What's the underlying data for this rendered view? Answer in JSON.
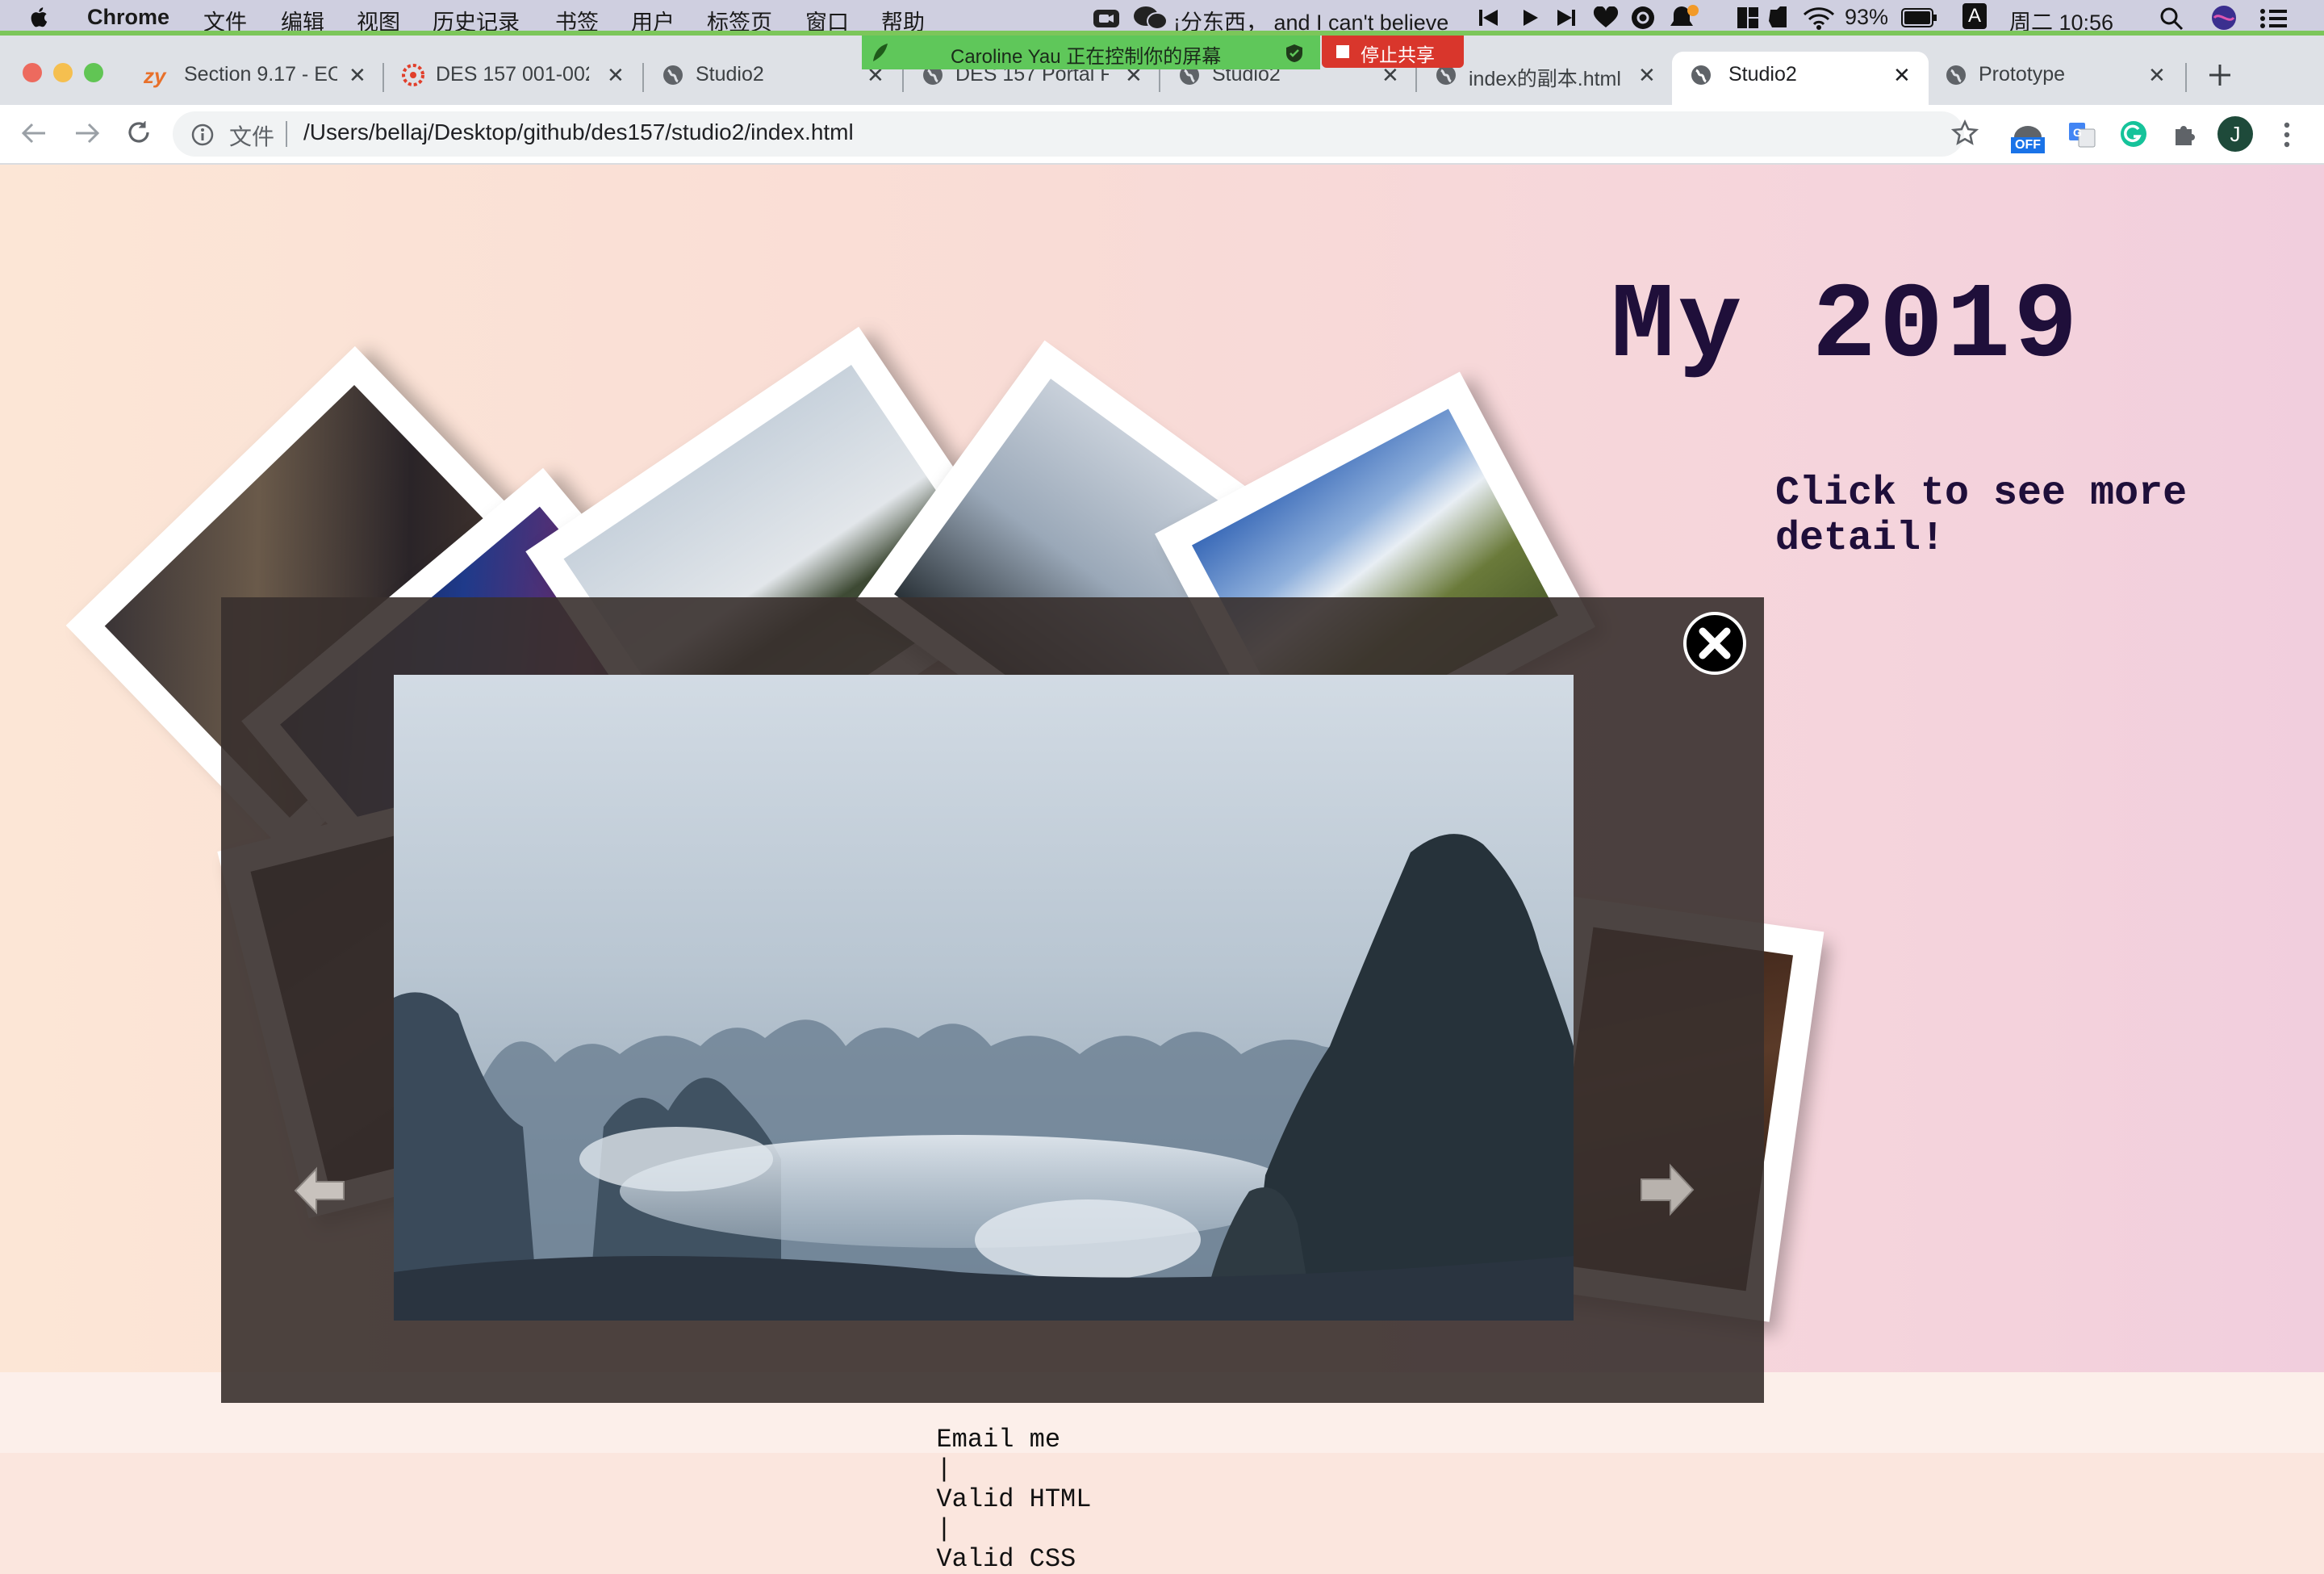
{
  "menubar": {
    "app": "Chrome",
    "items": [
      "文件",
      "编辑",
      "视图",
      "历史记录",
      "书签",
      "用户",
      "标签页",
      "窗口",
      "帮助"
    ],
    "now_playing": "¡分东西， and I can't believe",
    "battery": "93%",
    "clock": "周二 10:56",
    "input_method": "A"
  },
  "share_banner": {
    "text": "Caroline Yau 正在控制你的屏幕",
    "stop_label": "停止共享"
  },
  "tabs": [
    {
      "title": "Section 9.17 - EC",
      "favicon": "zy-icon",
      "active": false
    },
    {
      "title": "DES 157 001-002",
      "favicon": "canvas-icon",
      "active": false
    },
    {
      "title": "Studio2",
      "favicon": "globe-icon",
      "active": false
    },
    {
      "title": "DES 157 Portal F",
      "favicon": "globe-icon",
      "active": false
    },
    {
      "title": "Studio2",
      "favicon": "globe-icon",
      "active": false
    },
    {
      "title": "index的副本.html",
      "favicon": "globe-icon",
      "active": false
    },
    {
      "title": "Studio2",
      "favicon": "globe-icon",
      "active": true
    },
    {
      "title": "Prototype",
      "favicon": "globe-icon",
      "active": false
    }
  ],
  "toolbar": {
    "file_label": "文件",
    "url": "/Users/bellaj/Desktop/github/des157/studio2/index.html",
    "profile_initial": "J",
    "ext_badge": "OFF"
  },
  "page": {
    "title": "My 2019",
    "subtitle": "Click to see more detail!",
    "footer": {
      "email": "Email me",
      "html": "Valid HTML",
      "css": "Valid CSS",
      "separator": "|"
    }
  },
  "colors": {
    "heading": "#1f0f3a",
    "overlay": "#38302e",
    "share_green": "#5fc75a",
    "share_red": "#d9362c"
  }
}
